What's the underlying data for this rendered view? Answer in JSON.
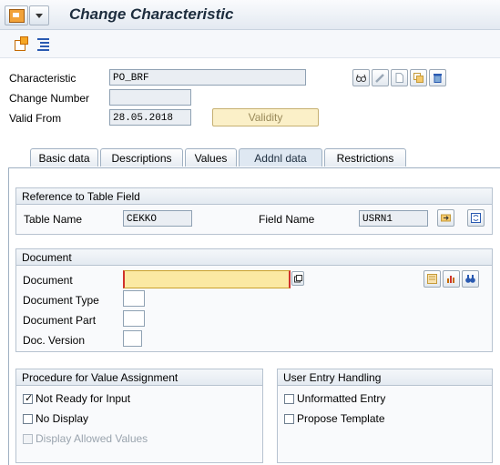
{
  "window": {
    "title": "Change Characteristic"
  },
  "header": {
    "characteristic_label": "Characteristic",
    "characteristic_value": "PO_BRF",
    "change_number_label": "Change Number",
    "change_number_value": "",
    "valid_from_label": "Valid From",
    "valid_from_value": "28.05.2018",
    "validity_button": "Validity"
  },
  "tabs": [
    {
      "label": "Basic data",
      "active": false
    },
    {
      "label": "Descriptions",
      "active": false
    },
    {
      "label": "Values",
      "active": false
    },
    {
      "label": "Addnl data",
      "active": true
    },
    {
      "label": "Restrictions",
      "active": false
    }
  ],
  "reference": {
    "title": "Reference to Table Field",
    "table_name_label": "Table Name",
    "table_name_value": "CEKKO",
    "field_name_label": "Field Name",
    "field_name_value": "USRN1"
  },
  "document": {
    "title": "Document",
    "document_label": "Document",
    "document_value": "",
    "document_type_label": "Document Type",
    "document_part_label": "Document Part",
    "doc_version_label": "Doc. Version"
  },
  "procedure": {
    "title": "Procedure for Value Assignment",
    "not_ready_label": "Not Ready for Input",
    "not_ready_checked": true,
    "no_display_label": "No Display",
    "display_allowed_label": "Display Allowed Values"
  },
  "user_entry": {
    "title": "User Entry Handling",
    "unformatted_label": "Unformatted Entry",
    "propose_template_label": "Propose Template"
  },
  "colors": {
    "accent": "#f5a623",
    "titlebar": "#e3e9f1",
    "field_highlight": "#fbe9a3"
  }
}
